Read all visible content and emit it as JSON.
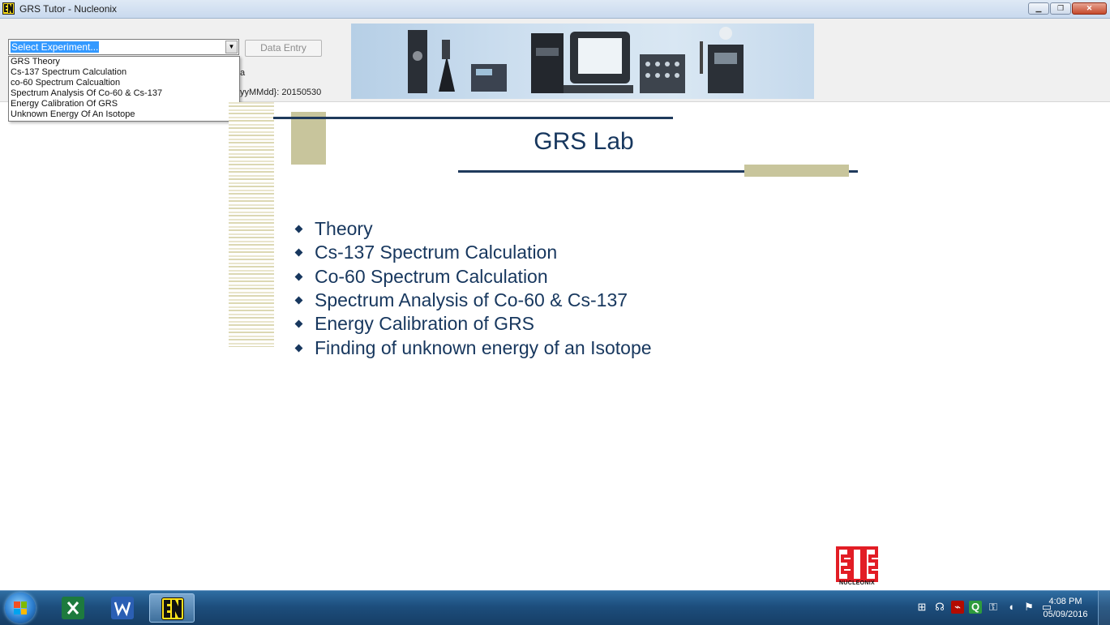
{
  "window": {
    "title": "GRS Tutor - Nucleonix",
    "minimize": "▁",
    "restore": "❐",
    "close": "✕"
  },
  "toolbar": {
    "experiment_select": "Select Experiment...",
    "data_entry": "Data Entry",
    "hidden_label": "a",
    "date_label": "yyMMdd}: 20150530",
    "experiments": [
      "GRS Theory",
      "Cs-137 Spectrum Calculation",
      "co-60 Spectrum Calcualtion",
      "Spectrum Analysis Of Co-60 & Cs-137",
      "Energy Calibration Of GRS",
      "Unknown Energy Of An Isotope"
    ]
  },
  "slide": {
    "title": "GRS Lab",
    "bullets": [
      "Theory",
      "Cs-137 Spectrum Calculation",
      "Co-60 Spectrum Calculation",
      "Spectrum Analysis of Co-60 & Cs-137",
      "Energy Calibration of GRS",
      "Finding of unknown energy of an Isotope"
    ],
    "logo_text": "NUCLEONIX",
    "colors": {
      "navy": "#17375e",
      "tan": "#c8c59c",
      "logo_red": "#e21d25"
    }
  },
  "taskbar": {
    "apps": [
      {
        "name": "excel-icon",
        "active": false
      },
      {
        "name": "word-icon",
        "active": false
      },
      {
        "name": "nucleonix-icon",
        "active": true
      }
    ],
    "tray_icons": [
      "windows-update-icon",
      "network-icon",
      "acrobat-icon",
      "q-icon",
      "lock-icon",
      "volume-icon",
      "flag-icon",
      "screen-icon"
    ],
    "time": "4:08 PM",
    "date": "05/09/2016"
  }
}
